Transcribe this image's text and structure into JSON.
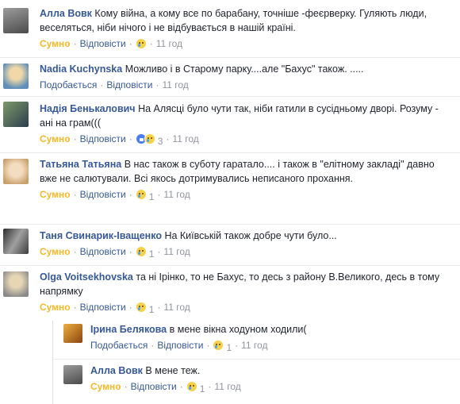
{
  "labels": {
    "reply": "Відповісти",
    "dot": "·"
  },
  "comments": [
    {
      "author": "Алла Вовк",
      "text": "Кому війна, а кому все по барабану, точніше -феєрверку. Гуляють люди, веселяться, ніби нічого і не відбувається в нашій країні.",
      "reaction_label": "Сумно",
      "reacted": true,
      "icons": [
        "sad-emoji"
      ],
      "count": "",
      "time": "11 год",
      "avatar_colors": [
        "#8a8a8a",
        "#3a3a3a"
      ]
    },
    {
      "author": "Nadia Kuchynska",
      "text": "Можливо і в Старому парку....але \"Бахус\" також. .....",
      "reaction_label": "Подобається",
      "reacted": false,
      "icons": [],
      "count": "",
      "time": "11 год",
      "avatar_colors": [
        "#e8c88a",
        "#6aa0c8"
      ]
    },
    {
      "author": "Надія Бенькалович",
      "text": "На Алясці було чути так, ніби гатили в сусідньому дворі. Розуму - ані на грам(((",
      "reaction_label": "Сумно",
      "reacted": true,
      "icons": [
        "like-emoji",
        "sad-emoji"
      ],
      "count": "3",
      "time": "11 год",
      "avatar_colors": [
        "#6a7f5a",
        "#2e3b4a"
      ]
    },
    {
      "author": "Татьяна Татьяна",
      "text": "В нас також в суботу гаратало.... і також в \"елітному закладі\" давно вже не салютували. Всі якось дотримувались неписаного прохання.",
      "reaction_label": "Сумно",
      "reacted": true,
      "icons": [
        "sad-emoji"
      ],
      "count": "1",
      "time": "11 год",
      "avatar_colors": [
        "#f1d7b0",
        "#c9a57a"
      ]
    },
    {
      "author": "Таня Свинарик-Іващенко",
      "text": "На Київській також добре чути було...",
      "reaction_label": "Сумно",
      "reacted": true,
      "icons": [
        "sad-emoji"
      ],
      "count": "1",
      "time": "11 год",
      "avatar_colors": [
        "#3a3a3a",
        "#9a9a9a"
      ]
    },
    {
      "author": "Olga Voitsekhovska",
      "text": "та ні Ірінко, то не Бахус, то десь з району В.Великого, десь в тому напрямку",
      "reaction_label": "Сумно",
      "reacted": true,
      "icons": [
        "sad-emoji"
      ],
      "count": "1",
      "time": "11 год",
      "avatar_colors": [
        "#d9c9a8",
        "#8c8c8c"
      ]
    },
    {
      "author": "Ірина Белякова",
      "text": "в мене вікна ходуном ходили(",
      "reaction_label": "Подобається",
      "reacted": false,
      "icons": [
        "sad-emoji"
      ],
      "count": "1",
      "time": "11 год",
      "avatar_colors": [
        "#e8a030",
        "#7a3a10"
      ]
    },
    {
      "author": "Алла Вовк",
      "text": "В мене теж.",
      "reaction_label": "Сумно",
      "reacted": true,
      "icons": [
        "sad-emoji"
      ],
      "count": "1",
      "time": "11 год",
      "avatar_colors": [
        "#8a8a8a",
        "#3a3a3a"
      ]
    }
  ]
}
